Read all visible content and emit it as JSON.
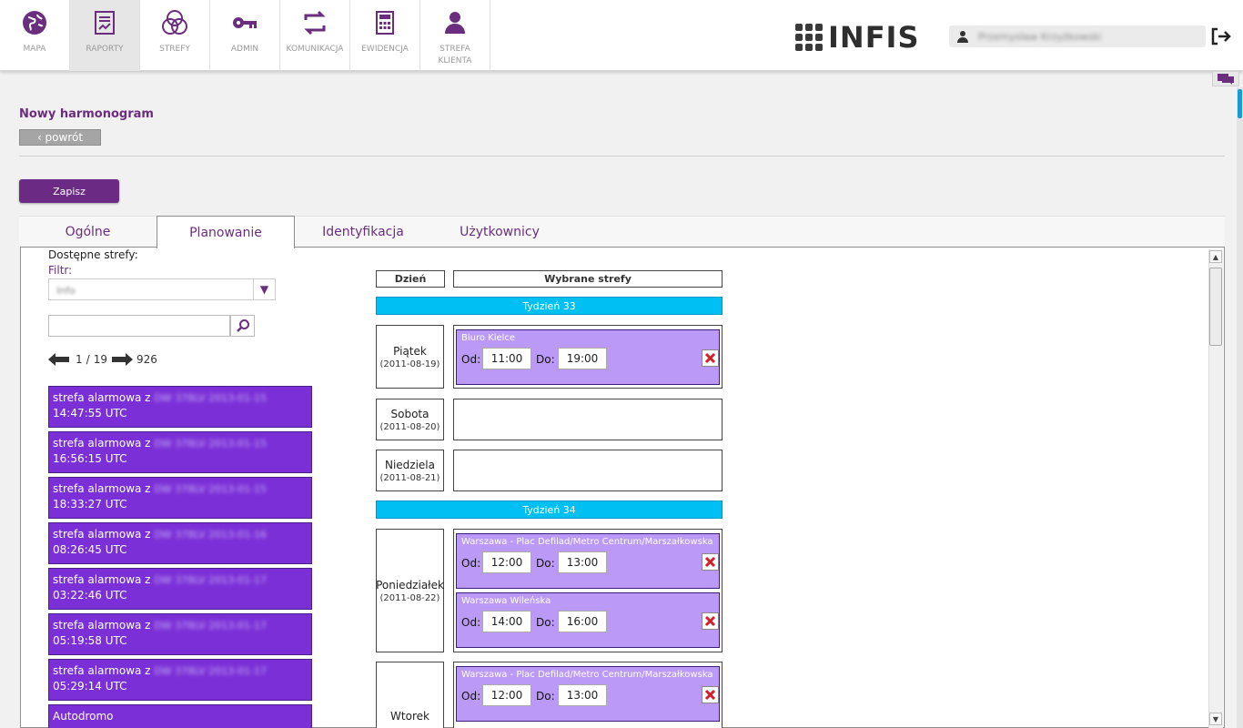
{
  "nav": [
    {
      "label": "MAPA",
      "icon": "globe-icon"
    },
    {
      "label": "RAPORTY",
      "icon": "report-icon",
      "active": true
    },
    {
      "label": "STREFY",
      "icon": "zones-icon"
    },
    {
      "label": "ADMIN",
      "icon": "key-icon"
    },
    {
      "label": "KOMUNIKACJA",
      "icon": "sync-icon"
    },
    {
      "label": "EWIDENCJA",
      "icon": "calculator-icon"
    },
    {
      "label": "STREFA KLIENTA",
      "icon": "user-icon"
    }
  ],
  "brand": {
    "name": "INFIS"
  },
  "user": {
    "name": "Przemysław Krzyżkowski"
  },
  "page": {
    "title": "Nowy harmonogram",
    "back_label": "‹ powrót",
    "save_label": "Zapisz"
  },
  "tabs": [
    "Ogólne",
    "Planowanie",
    "Identyfikacja",
    "Użytkownicy"
  ],
  "left": {
    "available_label": "Dostępne strefy:",
    "filter_label": "Filtr:",
    "filter_value": "Info",
    "search_value": "",
    "pager": {
      "page": "1",
      "sep": "/",
      "pages": "19",
      "total": "926"
    },
    "zones": [
      {
        "line1": "strefa alarmowa z",
        "blur": "DW 378LV 2013-01-15",
        "line2": "14:47:55 UTC"
      },
      {
        "line1": "strefa alarmowa z",
        "blur": "DW 378LV 2013-01-15",
        "line2": "16:56:15 UTC"
      },
      {
        "line1": "strefa alarmowa z",
        "blur": "DW 378LV 2013-01-15",
        "line2": "18:33:27 UTC"
      },
      {
        "line1": "strefa alarmowa z",
        "blur": "DW 378LV 2013-01-16",
        "line2": "08:26:45 UTC"
      },
      {
        "line1": "strefa alarmowa z",
        "blur": "DW 378LV 2013-01-17",
        "line2": "03:22:46 UTC"
      },
      {
        "line1": "strefa alarmowa z",
        "blur": "DW 378LV 2013-01-17",
        "line2": "05:19:58 UTC"
      },
      {
        "line1": "strefa alarmowa z",
        "blur": "DW 378LV 2013-01-17",
        "line2": "05:29:14 UTC"
      },
      {
        "line1": "Autodromo",
        "blur": "",
        "line2": ""
      }
    ]
  },
  "schedule": {
    "hdr_day": "Dzień",
    "hdr_zones": "Wybrane strefy",
    "od_label": "Od:",
    "do_label": "Do:",
    "week33": "Tydzień 33",
    "week34": "Tydzień 34",
    "days": [
      {
        "name": "Piątek",
        "date": "(2011-08-19)",
        "entries": [
          {
            "zone": "Biuro Kielce",
            "from": "11:00",
            "to": "19:00"
          }
        ]
      },
      {
        "name": "Sobota",
        "date": "(2011-08-20)",
        "entries": []
      },
      {
        "name": "Niedziela",
        "date": "(2011-08-21)",
        "entries": []
      },
      {
        "name": "Poniedziałek",
        "date": "(2011-08-22)",
        "entries": [
          {
            "zone": "Warszawa - Plac Defilad/Metro Centrum/Marszałkowska",
            "from": "12:00",
            "to": "13:00"
          },
          {
            "zone": "Warszawa Wileńska",
            "from": "14:00",
            "to": "16:00"
          }
        ]
      },
      {
        "name": "Wtorek",
        "date": "",
        "entries": [
          {
            "zone": "Warszawa - Plac Defilad/Metro Centrum/Marszałkowska",
            "from": "12:00",
            "to": "13:00"
          }
        ]
      }
    ]
  },
  "colors": {
    "accent": "#6b2d7e",
    "zone": "#7b2fd7",
    "entry": "#bb99f7",
    "week": "#00bff3"
  }
}
